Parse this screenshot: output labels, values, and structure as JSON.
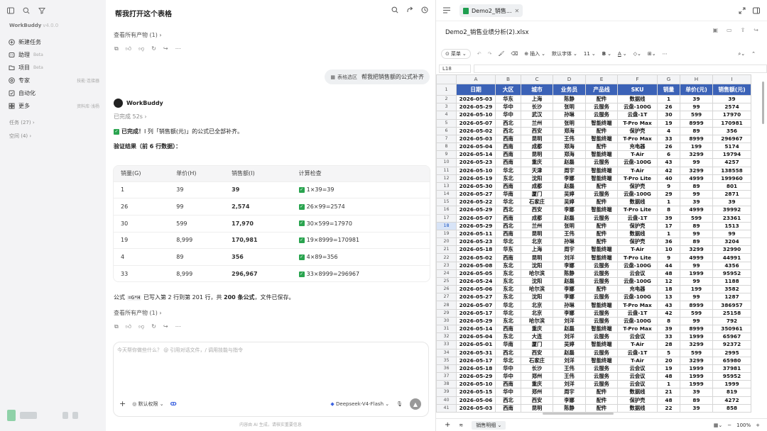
{
  "sidebar": {
    "brand": "WorkBuddy",
    "version": "v4.0.0",
    "items": [
      {
        "label": "新建任务",
        "icon": "new-task-icon",
        "badge": "",
        "right": ""
      },
      {
        "label": "助理",
        "icon": "assistant-icon",
        "badge": "Beta",
        "right": ""
      },
      {
        "label": "项目",
        "icon": "project-icon",
        "badge": "Beta",
        "right": ""
      },
      {
        "label": "专家",
        "icon": "expert-icon",
        "badge": "",
        "right": "技能·连接器"
      },
      {
        "label": "自动化",
        "icon": "automation-icon",
        "badge": "",
        "right": ""
      },
      {
        "label": "更多",
        "icon": "more-icon",
        "badge": "",
        "right": "资料库·浅杨"
      }
    ],
    "sections": {
      "tasks": "任务 (27)",
      "spaces": "空间 (4)"
    }
  },
  "chat": {
    "title": "帮我打开这个表格",
    "artifacts_link": "查看所有产物 (1)",
    "user_bubble": {
      "chip": "表格选区",
      "text": "帮我把销售额的公式补齐"
    },
    "assistant": "WorkBuddy",
    "status": "已完成 52s",
    "done_prefix": "已完成！",
    "done_rest": "I 列「销售额(元)」的公式已全部补齐。",
    "verify_title": "验证结果（前 6 行数据）：",
    "table": {
      "headers": [
        "销量(G)",
        "单价(H)",
        "销售额(I)",
        "计算检查"
      ],
      "rows": [
        [
          "1",
          "39",
          "39",
          "1×39=39"
        ],
        [
          "26",
          "99",
          "2,574",
          "26×99=2574"
        ],
        [
          "30",
          "599",
          "17,970",
          "30×599=17970"
        ],
        [
          "19",
          "8,999",
          "170,981",
          "19×8999=170981"
        ],
        [
          "4",
          "89",
          "356",
          "4×89=356"
        ],
        [
          "33",
          "8,999",
          "296,967",
          "33×8999=296967"
        ]
      ]
    },
    "summary": {
      "p1": "公式",
      "code": "=G*H",
      "p2": "已写入第 2 行到第 201 行，共",
      "count": "200 条公式",
      "p3": "，文件已保存。"
    },
    "input_placeholder": "今天帮你做些什么？ @ 引用对话文件，/ 调用技能与指令",
    "permission": "默认权限",
    "model": "Deepseek-V4-Flash",
    "footer_note": "内容由 AI 生成，请核实重要信息"
  },
  "spreadsheet": {
    "tab_title": "Demo2_销售...",
    "filename": "Demo2_销售业绩分析(2).xlsx",
    "toolbar": {
      "menu": "菜单",
      "insert": "插入",
      "font": "默认字体",
      "size": "11"
    },
    "cell_ref": "L18",
    "col_letters": [
      "A",
      "B",
      "C",
      "D",
      "E",
      "F",
      "G",
      "H",
      "I"
    ],
    "headers": [
      "日期",
      "大区",
      "城市",
      "业务员",
      "产品线",
      "SKU",
      "销量",
      "单价(元)",
      "销售额(元)"
    ],
    "rows": [
      [
        "2026-05-03",
        "华东",
        "上海",
        "陈静",
        "配件",
        "数据线",
        "1",
        "39",
        "39"
      ],
      [
        "2026-05-29",
        "华中",
        "长沙",
        "张明",
        "云服务",
        "云盘-100G",
        "26",
        "99",
        "2574"
      ],
      [
        "2026-05-10",
        "华中",
        "武汉",
        "孙琳",
        "云服务",
        "云盘-1T",
        "30",
        "599",
        "17970"
      ],
      [
        "2026-05-07",
        "西北",
        "兰州",
        "张明",
        "智能终端",
        "T-Pro Max",
        "19",
        "8999",
        "170981"
      ],
      [
        "2026-05-02",
        "西北",
        "西安",
        "郑海",
        "配件",
        "保护壳",
        "4",
        "89",
        "356"
      ],
      [
        "2026-05-03",
        "西南",
        "昆明",
        "王伟",
        "智能终端",
        "T-Pro Max",
        "33",
        "8999",
        "296967"
      ],
      [
        "2026-05-04",
        "西南",
        "成都",
        "郑海",
        "配件",
        "充电器",
        "26",
        "199",
        "5174"
      ],
      [
        "2026-05-14",
        "西南",
        "昆明",
        "郑海",
        "智能终端",
        "T-Air",
        "6",
        "3299",
        "19794"
      ],
      [
        "2026-05-23",
        "西南",
        "重庆",
        "赵磊",
        "云服务",
        "云盘-100G",
        "43",
        "99",
        "4257"
      ],
      [
        "2026-05-10",
        "华北",
        "天津",
        "周宇",
        "智能终端",
        "T-Air",
        "42",
        "3299",
        "138558"
      ],
      [
        "2026-05-19",
        "东北",
        "沈阳",
        "李娜",
        "智能终端",
        "T-Pro Lite",
        "40",
        "4999",
        "199960"
      ],
      [
        "2026-05-30",
        "西南",
        "成都",
        "赵磊",
        "配件",
        "保护壳",
        "9",
        "89",
        "801"
      ],
      [
        "2026-05-27",
        "华南",
        "厦门",
        "吴婷",
        "云服务",
        "云盘-100G",
        "29",
        "99",
        "2871"
      ],
      [
        "2026-05-22",
        "华北",
        "石家庄",
        "吴婷",
        "配件",
        "数据线",
        "1",
        "39",
        "39"
      ],
      [
        "2026-05-29",
        "西北",
        "西安",
        "李娜",
        "智能终端",
        "T-Pro Lite",
        "8",
        "4999",
        "39992"
      ],
      [
        "2026-05-07",
        "西南",
        "成都",
        "赵磊",
        "云服务",
        "云盘-1T",
        "39",
        "599",
        "23361"
      ],
      [
        "2026-05-29",
        "西北",
        "兰州",
        "张明",
        "配件",
        "保护壳",
        "17",
        "89",
        "1513"
      ],
      [
        "2026-05-11",
        "西南",
        "昆明",
        "王伟",
        "配件",
        "数据线",
        "1",
        "99",
        "99"
      ],
      [
        "2026-05-23",
        "华北",
        "北京",
        "孙琳",
        "配件",
        "保护壳",
        "36",
        "89",
        "3204"
      ],
      [
        "2026-05-18",
        "华东",
        "上海",
        "周宇",
        "智能终端",
        "T-Air",
        "10",
        "3299",
        "32990"
      ],
      [
        "2026-05-02",
        "西南",
        "昆明",
        "刘洋",
        "智能终端",
        "T-Pro Lite",
        "9",
        "4999",
        "44991"
      ],
      [
        "2026-05-08",
        "东北",
        "沈阳",
        "李娜",
        "云服务",
        "云盘-100G",
        "44",
        "99",
        "4356"
      ],
      [
        "2026-05-05",
        "东北",
        "哈尔滨",
        "陈静",
        "云服务",
        "云会议",
        "48",
        "1999",
        "95952"
      ],
      [
        "2026-05-24",
        "东北",
        "沈阳",
        "赵磊",
        "云服务",
        "云盘-100G",
        "12",
        "99",
        "1188"
      ],
      [
        "2026-05-06",
        "东北",
        "哈尔滨",
        "李娜",
        "配件",
        "充电器",
        "18",
        "199",
        "3582"
      ],
      [
        "2026-05-27",
        "东北",
        "沈阳",
        "李娜",
        "云服务",
        "云盘-100G",
        "13",
        "99",
        "1287"
      ],
      [
        "2026-05-07",
        "华北",
        "北京",
        "孙琳",
        "智能终端",
        "T-Pro Max",
        "43",
        "8999",
        "386957"
      ],
      [
        "2026-05-17",
        "华北",
        "北京",
        "李娜",
        "云服务",
        "云盘-1T",
        "42",
        "599",
        "25158"
      ],
      [
        "2026-05-29",
        "东北",
        "哈尔滨",
        "刘洋",
        "云服务",
        "云盘-100G",
        "8",
        "99",
        "792"
      ],
      [
        "2026-05-14",
        "西南",
        "重庆",
        "赵磊",
        "智能终端",
        "T-Pro Max",
        "39",
        "8999",
        "350961"
      ],
      [
        "2026-05-04",
        "东北",
        "大连",
        "刘洋",
        "云服务",
        "云会议",
        "33",
        "1999",
        "65967"
      ],
      [
        "2026-05-01",
        "华南",
        "厦门",
        "吴婷",
        "智能终端",
        "T-Air",
        "28",
        "3299",
        "92372"
      ],
      [
        "2026-05-31",
        "西北",
        "西安",
        "赵磊",
        "云服务",
        "云盘-1T",
        "5",
        "599",
        "2995"
      ],
      [
        "2026-05-17",
        "华北",
        "石家庄",
        "刘洋",
        "智能终端",
        "T-Air",
        "20",
        "3299",
        "65980"
      ],
      [
        "2026-05-18",
        "华中",
        "长沙",
        "王伟",
        "云服务",
        "云会议",
        "19",
        "1999",
        "37981"
      ],
      [
        "2026-05-29",
        "华中",
        "郑州",
        "王伟",
        "云服务",
        "云会议",
        "48",
        "1999",
        "95952"
      ],
      [
        "2026-05-10",
        "西南",
        "重庆",
        "刘洋",
        "云服务",
        "云会议",
        "1",
        "1999",
        "1999"
      ],
      [
        "2026-05-15",
        "华中",
        "郑州",
        "周宇",
        "配件",
        "数据线",
        "21",
        "39",
        "819"
      ],
      [
        "2026-05-06",
        "西北",
        "西安",
        "李娜",
        "配件",
        "保护壳",
        "48",
        "89",
        "4272"
      ],
      [
        "2026-05-03",
        "西南",
        "昆明",
        "陈静",
        "配件",
        "数据线",
        "22",
        "39",
        "858"
      ]
    ],
    "sheet_tab": "销售明细",
    "zoom": "100%"
  }
}
